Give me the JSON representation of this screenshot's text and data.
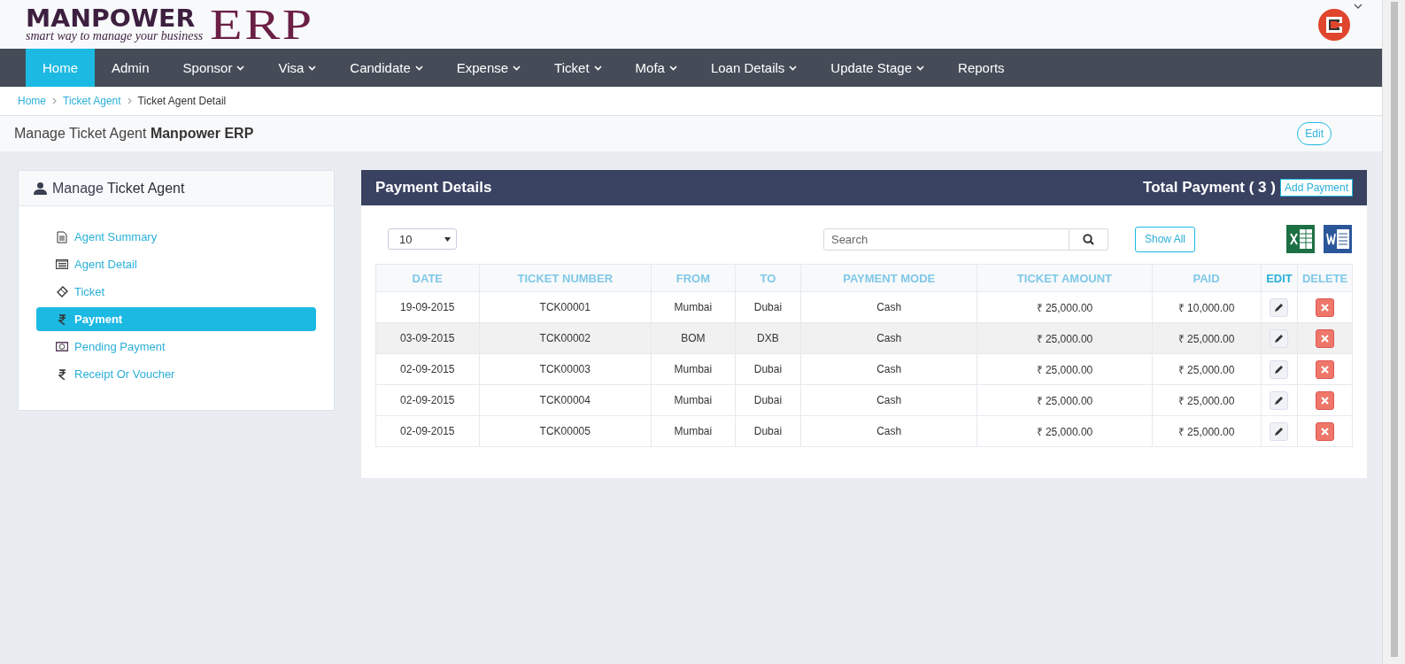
{
  "logo": {
    "brand": "MANPOWER",
    "product": "ERP",
    "tagline": "smart way to manage your business"
  },
  "nav": [
    {
      "label": "Home",
      "selected": true,
      "dropdown": false
    },
    {
      "label": "Admin",
      "selected": false,
      "dropdown": false
    },
    {
      "label": "Sponsor",
      "selected": false,
      "dropdown": true
    },
    {
      "label": "Visa",
      "selected": false,
      "dropdown": true
    },
    {
      "label": "Candidate",
      "selected": false,
      "dropdown": true
    },
    {
      "label": "Expense",
      "selected": false,
      "dropdown": true
    },
    {
      "label": "Ticket",
      "selected": false,
      "dropdown": true
    },
    {
      "label": "Mofa",
      "selected": false,
      "dropdown": true
    },
    {
      "label": "Loan Details",
      "selected": false,
      "dropdown": true
    },
    {
      "label": "Update Stage",
      "selected": false,
      "dropdown": true
    },
    {
      "label": "Reports",
      "selected": false,
      "dropdown": false
    }
  ],
  "breadcrumb": [
    "Home",
    "Ticket Agent",
    "Ticket Agent Detail"
  ],
  "page_title": {
    "prefix": "Manage Ticket Agent",
    "name": "Manpower ERP",
    "edit_button": "Edit"
  },
  "sidebar": {
    "title_prefix": "Manage",
    "title": "Ticket Agent",
    "items": [
      {
        "label": "Agent Summary",
        "kind": "document",
        "selected": false
      },
      {
        "label": "Agent Detail",
        "kind": "list",
        "selected": false
      },
      {
        "label": "Ticket",
        "kind": "ticket",
        "selected": false
      },
      {
        "label": "Payment",
        "kind": "rupee",
        "selected": true
      },
      {
        "label": "Pending Payment",
        "kind": "money",
        "selected": false
      },
      {
        "label": "Receipt Or Voucher",
        "kind": "rupee",
        "selected": false
      }
    ]
  },
  "panel": {
    "title": "Payment Details",
    "total": "Total Payment ( 3 )",
    "add_button": "Add Payment",
    "page_size": "10",
    "search_placeholder": "Search",
    "show_all": "Show All",
    "table": {
      "columns": [
        "DATE",
        "TICKET NUMBER",
        "FROM",
        "TO",
        "PAYMENT MODE",
        "TICKET AMOUNT",
        "PAID",
        "EDIT",
        "DELETE"
      ],
      "rows": [
        {
          "highlighted": false,
          "cells": [
            "19-09-2015",
            "TCK00001",
            "Mumbai",
            "Dubai",
            "Cash",
            "₹ 25,000.00",
            "₹ 10,000.00"
          ]
        },
        {
          "highlighted": true,
          "cells": [
            "03-09-2015",
            "TCK00002",
            "BOM",
            "DXB",
            "Cash",
            "₹ 25,000.00",
            "₹ 25,000.00"
          ]
        },
        {
          "highlighted": false,
          "cells": [
            "02-09-2015",
            "TCK00003",
            "Mumbai",
            "Dubai",
            "Cash",
            "₹ 25,000.00",
            "₹ 25,000.00"
          ]
        },
        {
          "highlighted": false,
          "cells": [
            "02-09-2015",
            "TCK00004",
            "Mumbai",
            "Dubai",
            "Cash",
            "₹ 25,000.00",
            "₹ 25,000.00"
          ]
        },
        {
          "highlighted": false,
          "cells": [
            "02-09-2015",
            "TCK00005",
            "Mumbai",
            "Dubai",
            "Cash",
            "₹ 25,000.00",
            "₹ 25,000.00"
          ]
        }
      ]
    }
  }
}
